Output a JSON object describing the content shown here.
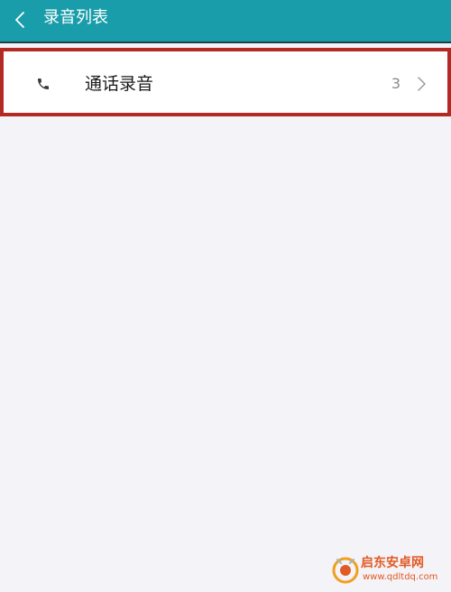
{
  "app_bar": {
    "title": "录音列表",
    "back_icon": "chevron-left-icon",
    "color": "#1a9daa"
  },
  "list": {
    "items": [
      {
        "icon": "phone-icon",
        "label": "通话录音",
        "count": "3",
        "chevron_icon": "chevron-right-icon"
      }
    ]
  },
  "highlight_color": "#b22a23",
  "watermark": {
    "name": "启东安卓网",
    "url": "www.qdltdq.com"
  }
}
